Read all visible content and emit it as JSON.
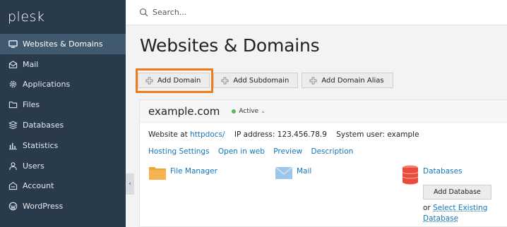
{
  "app": {
    "logo_text": "plesk"
  },
  "sidebar": {
    "items": [
      {
        "label": "Websites & Domains",
        "icon": "monitor-icon",
        "active": true
      },
      {
        "label": "Mail",
        "icon": "mail-icon",
        "active": false
      },
      {
        "label": "Applications",
        "icon": "gear-icon",
        "active": false
      },
      {
        "label": "Files",
        "icon": "folder-icon",
        "active": false
      },
      {
        "label": "Databases",
        "icon": "database-icon",
        "active": false
      },
      {
        "label": "Statistics",
        "icon": "bar-chart-icon",
        "active": false
      },
      {
        "label": "Users",
        "icon": "user-icon",
        "active": false
      },
      {
        "label": "Account",
        "icon": "account-icon",
        "active": false
      },
      {
        "label": "WordPress",
        "icon": "wordpress-icon",
        "active": false
      }
    ],
    "collapse_glyph": "‹"
  },
  "search": {
    "placeholder": "Search..."
  },
  "page": {
    "title": "Websites & Domains"
  },
  "toolbar": {
    "add_domain": "Add Domain",
    "add_subdomain": "Add Subdomain",
    "add_domain_alias": "Add Domain Alias"
  },
  "domain": {
    "name": "example.com",
    "status": "Active",
    "status_color": "#5cb85c",
    "website_at_label": "Website at",
    "website_at_link": "httpdocs/",
    "ip_label": "IP address:",
    "ip_value": "123.456.78.9",
    "system_user_label": "System user:",
    "system_user_value": "example",
    "links": [
      "Hosting Settings",
      "Open in web",
      "Preview",
      "Description"
    ],
    "tools": {
      "file_manager": "File Manager",
      "mail": "Mail",
      "databases": "Databases",
      "add_database": "Add Database",
      "or_text": "or",
      "select_existing": "Select Existing",
      "database_word": "Database"
    }
  },
  "colors": {
    "sidebar_bg": "#293a4b",
    "active_item": "#41596f",
    "link": "#1576b8",
    "highlight": "#f07b1b"
  }
}
